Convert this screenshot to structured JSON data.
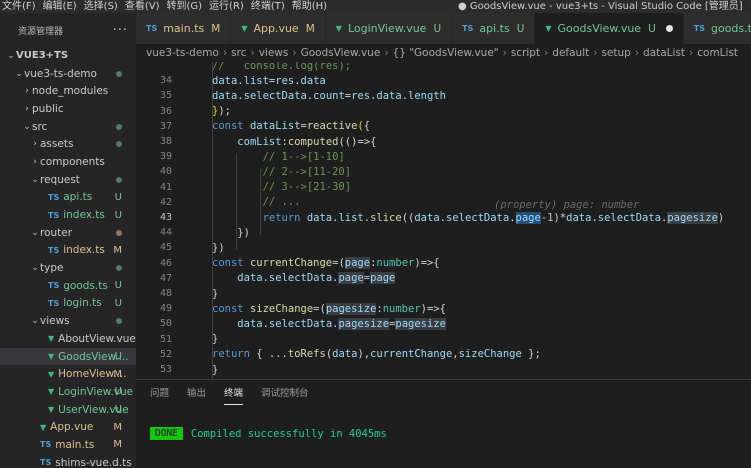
{
  "menu": [
    "文件(F)",
    "编辑(E)",
    "选择(S)",
    "查看(V)",
    "转到(G)",
    "运行(R)",
    "终端(T)",
    "帮助(H)"
  ],
  "window_title": "● GoodsView.vue - vue3+ts - Visual Studio Code [管理员]",
  "sidebar": {
    "header": "资源管理器",
    "more": "···",
    "root": "VUE3+TS",
    "items": [
      {
        "label": "vue3-ts-demo",
        "type": "folder",
        "open": true,
        "indent": 1,
        "badge": "dot"
      },
      {
        "label": "node_modules",
        "type": "folder",
        "open": false,
        "indent": 2,
        "badge": ""
      },
      {
        "label": "public",
        "type": "folder",
        "open": false,
        "indent": 2,
        "badge": ""
      },
      {
        "label": "src",
        "type": "folder",
        "open": true,
        "indent": 2,
        "badge": "dot"
      },
      {
        "label": "assets",
        "type": "folder",
        "open": false,
        "indent": 3,
        "badge": "dot"
      },
      {
        "label": "components",
        "type": "folder",
        "open": false,
        "indent": 3,
        "badge": ""
      },
      {
        "label": "request",
        "type": "folder",
        "open": true,
        "indent": 3,
        "badge": "dot"
      },
      {
        "label": "api.ts",
        "type": "ts",
        "indent": 4,
        "badge": "U"
      },
      {
        "label": "index.ts",
        "type": "ts",
        "indent": 4,
        "badge": "U"
      },
      {
        "label": "router",
        "type": "folder",
        "open": true,
        "indent": 3,
        "badge": "dot-y"
      },
      {
        "label": "index.ts",
        "type": "ts",
        "indent": 4,
        "badge": "M"
      },
      {
        "label": "type",
        "type": "folder",
        "open": true,
        "indent": 3,
        "badge": "dot"
      },
      {
        "label": "goods.ts",
        "type": "ts",
        "indent": 4,
        "badge": "U"
      },
      {
        "label": "login.ts",
        "type": "ts",
        "indent": 4,
        "badge": "U"
      },
      {
        "label": "views",
        "type": "folder",
        "open": true,
        "indent": 3,
        "badge": "dot"
      },
      {
        "label": "AboutView.vue",
        "type": "vue",
        "indent": 4,
        "badge": ""
      },
      {
        "label": "GoodsView....",
        "type": "vue",
        "indent": 4,
        "badge": "U",
        "selected": true
      },
      {
        "label": "HomeView....",
        "type": "vue",
        "indent": 4,
        "badge": "M"
      },
      {
        "label": "LoginView.vue",
        "type": "vue",
        "indent": 4,
        "badge": "U"
      },
      {
        "label": "UserView.vue",
        "type": "vue",
        "indent": 4,
        "badge": "U"
      },
      {
        "label": "App.vue",
        "type": "vue",
        "indent": 3,
        "badge": "M"
      },
      {
        "label": "main.ts",
        "type": "ts",
        "indent": 3,
        "badge": "M"
      },
      {
        "label": "shims-vue.d.ts",
        "type": "ts",
        "indent": 3,
        "badge": ""
      }
    ]
  },
  "tabs": [
    {
      "icon": "TS",
      "label": "main.ts",
      "badge": "M",
      "active": false
    },
    {
      "icon": "V",
      "label": "App.vue",
      "badge": "M",
      "active": false
    },
    {
      "icon": "V",
      "label": "LoginView.vue",
      "badge": "U",
      "active": false
    },
    {
      "icon": "TS",
      "label": "api.ts",
      "badge": "U",
      "active": false
    },
    {
      "icon": "V",
      "label": "GoodsView.vue",
      "badge": "U",
      "active": true
    },
    {
      "icon": "TS",
      "label": "goods.ts",
      "badge": "U",
      "active": false
    }
  ],
  "breadcrumb": [
    "vue3-ts-demo",
    "src",
    "views",
    "GoodsView.vue",
    "{} \"GoodsView.vue\"",
    "script",
    "default",
    "setup",
    "dataList",
    "comList"
  ],
  "editor": {
    "current_line": 43,
    "hint": "(property) page: number",
    "lines": [
      {
        "n": "",
        "html": "<span class=\"c\">//   console.log(res);</span>"
      },
      {
        "n": "34",
        "html": "<span class=\"v\">data</span><span class=\"p\">.</span><span class=\"v\">list</span><span class=\"p\">=</span><span class=\"v\">res</span><span class=\"p\">.</span><span class=\"v\">data</span>"
      },
      {
        "n": "35",
        "html": "<span class=\"v\">data</span><span class=\"p\">.</span><span class=\"v\">selectData</span><span class=\"p\">.</span><span class=\"v\">count</span><span class=\"p\">=</span><span class=\"v\">res</span><span class=\"p\">.</span><span class=\"v\">data</span><span class=\"p\">.</span><span class=\"v\">length</span>"
      },
      {
        "n": "36",
        "html": "<span class=\"b\">}</span><span class=\"p\">);</span>"
      },
      {
        "n": "37",
        "html": "<span class=\"k\">const</span> <span class=\"v\">dataList</span><span class=\"p\">=</span><span class=\"f\">reactive</span><span class=\"b\">(</span><span class=\"p\">{</span>"
      },
      {
        "n": "38",
        "html": "    <span class=\"v\">comList</span><span class=\"p\">:</span><span class=\"f\">computed</span><span class=\"p\">(</span><span class=\"p\">()=&gt;{</span>"
      },
      {
        "n": "39",
        "html": "        <span class=\"c\">// 1--&gt;[1-10]</span>"
      },
      {
        "n": "40",
        "html": "        <span class=\"c\">// 2--&gt;[11-20]</span>"
      },
      {
        "n": "41",
        "html": "        <span class=\"c\">// 3--&gt;[21-30]</span>"
      },
      {
        "n": "42",
        "html": "        <span class=\"c\">// ...</span>"
      },
      {
        "n": "43",
        "html": "        <span class=\"k\">return</span> <span class=\"v\">data</span><span class=\"p\">.</span><span class=\"v\">list</span><span class=\"p\">.</span><span class=\"f\">slice</span><span class=\"p\">((</span><span class=\"v\">data</span><span class=\"p\">.</span><span class=\"v\">selectData</span><span class=\"p\">.</span><span class=\"v hl2\">page</span><span class=\"p\">-</span><span class=\"n\">1</span><span class=\"p\">)*</span><span class=\"v\">data</span><span class=\"p\">.</span><span class=\"v\">selectData</span><span class=\"p\">.</span><span class=\"v hl\">pagesize</span><span class=\"p\">)</span>"
      },
      {
        "n": "44",
        "html": "    <span class=\"p\">})</span>"
      },
      {
        "n": "45",
        "html": "<span class=\"p\">})</span>"
      },
      {
        "n": "46",
        "html": "<span class=\"k\">const</span> <span class=\"f\">currentChange</span><span class=\"p\">=(</span><span class=\"v hl\">page</span><span class=\"p\">:</span><span class=\"t\">number</span><span class=\"p\">)=&gt;{</span>"
      },
      {
        "n": "47",
        "html": "    <span class=\"v\">data</span><span class=\"p\">.</span><span class=\"v\">selectData</span><span class=\"p\">.</span><span class=\"v hl\">page</span><span class=\"p\">=</span><span class=\"v hl\">page</span>"
      },
      {
        "n": "48",
        "html": "<span class=\"p\">}</span>"
      },
      {
        "n": "49",
        "html": "<span class=\"k\">const</span> <span class=\"f\">sizeChange</span><span class=\"p\">=(</span><span class=\"v hl\">pagesize</span><span class=\"p\">:</span><span class=\"t\">number</span><span class=\"p\">)=&gt;{</span>"
      },
      {
        "n": "50",
        "html": "    <span class=\"v\">data</span><span class=\"p\">.</span><span class=\"v\">selectData</span><span class=\"p\">.</span><span class=\"v hl\">pagesize</span><span class=\"p\">=</span><span class=\"v hl\">pagesize</span>"
      },
      {
        "n": "51",
        "html": "<span class=\"p\">}</span>"
      },
      {
        "n": "52",
        "html": "<span class=\"k\">return</span> <span class=\"p\">{ ...</span><span class=\"f\">toRefs</span><span class=\"p\">(</span><span class=\"v\">data</span><span class=\"p\">),</span><span class=\"v\">currentChange</span><span class=\"p\">,</span><span class=\"v\">sizeChange</span> <span class=\"p\">};</span>"
      },
      {
        "n": "53",
        "html": "<span class=\"p\">}</span>"
      }
    ]
  },
  "panel": {
    "tabs": [
      "问题",
      "输出",
      "终端",
      "调试控制台"
    ],
    "active_tab": 2,
    "terminal": {
      "badge": "DONE",
      "message": "Compiled successfully in 4045ms"
    }
  }
}
